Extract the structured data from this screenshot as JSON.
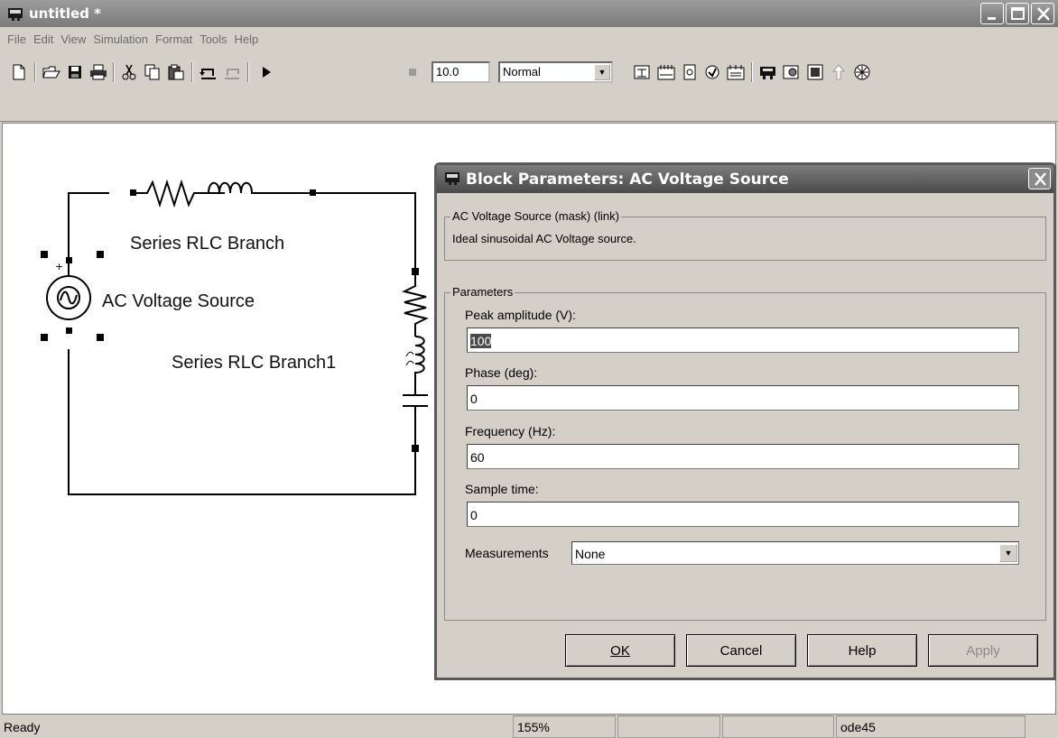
{
  "window": {
    "title": "untitled *"
  },
  "menu": [
    "File",
    "Edit",
    "View",
    "Simulation",
    "Format",
    "Tools",
    "Help"
  ],
  "toolbar": {
    "stop_time": "10.0",
    "sim_mode": "Normal"
  },
  "diagram": {
    "labels": {
      "rlc_branch": "Series RLC Branch",
      "ac_source": "AC Voltage Source",
      "rlc_branch1": "Series RLC Branch1"
    }
  },
  "dialog": {
    "title": "Block Parameters: AC Voltage Source",
    "mask_group": "AC Voltage Source (mask) (link)",
    "description": "Ideal sinusoidal AC Voltage source.",
    "params_group": "Parameters",
    "fields": [
      {
        "label": "Peak amplitude (V):",
        "value": "100"
      },
      {
        "label": "Phase (deg):",
        "value": "0"
      },
      {
        "label": "Frequency (Hz):",
        "value": "60"
      },
      {
        "label": "Sample time:",
        "value": "0"
      }
    ],
    "measurements_label": "Measurements",
    "measurements_value": "None",
    "buttons": {
      "ok": "OK",
      "cancel": "Cancel",
      "help": "Help",
      "apply": "Apply"
    }
  },
  "status": {
    "text": "Ready",
    "zoom": "155%",
    "solver": "ode45"
  }
}
